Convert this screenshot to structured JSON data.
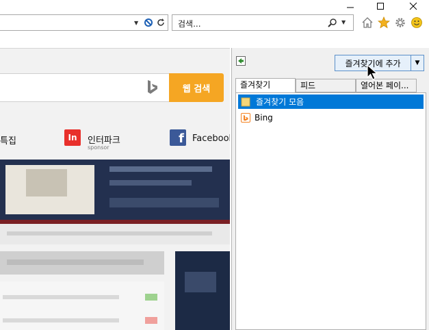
{
  "toolbar": {
    "search_placeholder": "검색...",
    "search_icon": "search-icon",
    "nav_icons": [
      "home-icon",
      "star-icon",
      "gear-icon",
      "smiley-icon"
    ],
    "accent_star": "#f2b01e",
    "accent_smiley": "#f2c319"
  },
  "page": {
    "bing_search_button": "웹 검색",
    "shortcuts": [
      {
        "label": "특집"
      },
      {
        "label": "인터파크",
        "sub": "sponsor"
      },
      {
        "label": "Facebook"
      }
    ],
    "bing_button_color": "#f5a623"
  },
  "favorites_pane": {
    "add_button": "즐겨찾기에 추가",
    "tabs": [
      "즐겨찾기",
      "피드",
      "열어본 페이..."
    ],
    "items": [
      {
        "label": "즐겨찾기 모음",
        "icon": "folder-icon",
        "selected": true
      },
      {
        "label": "Bing",
        "icon": "bing-icon",
        "selected": false
      }
    ],
    "selection_color": "#0078d7"
  }
}
